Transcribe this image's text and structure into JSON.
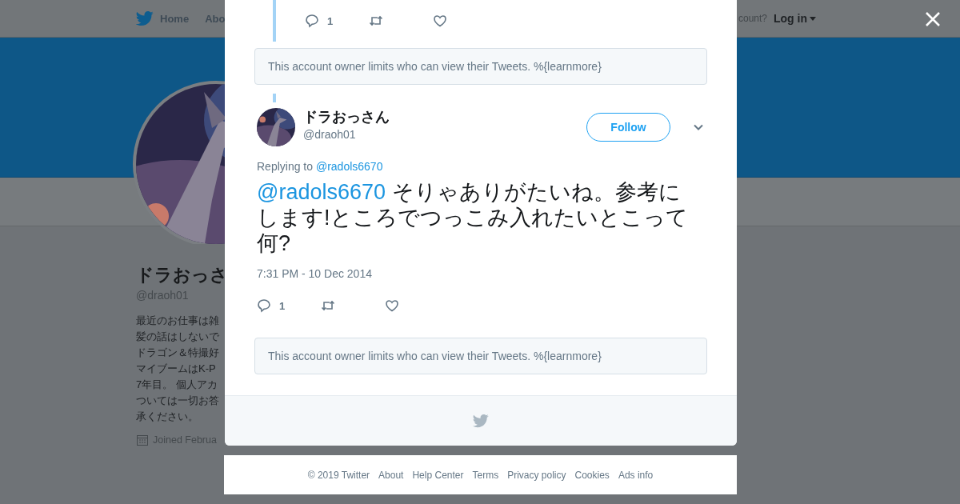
{
  "nav": {
    "items": [
      {
        "label": "Home"
      },
      {
        "label": "Abo"
      }
    ],
    "account_prompt": "count?",
    "login": "Log in"
  },
  "profile": {
    "name": "ドラおっさ",
    "handle": "@draoh01",
    "bio_lines": [
      "最近のお仕事は雑",
      "髪の話はしないで",
      "ドラゴン＆特撮好",
      "マイブームはK-P",
      "7年目。 個人アカ",
      "ついては一切お答",
      "承ください。"
    ],
    "joined": "Joined Februa"
  },
  "modal": {
    "previous_tweet": {
      "reply_count": "1"
    },
    "notices": [
      "This account owner limits who can view their Tweets. %{learnmore}",
      "This account owner limits who can view their Tweets. %{learnmore}"
    ],
    "tweet": {
      "name": "ドラおっさん",
      "handle": "@draoh01",
      "follow_label": "Follow",
      "replying_label": "Replying to",
      "replying_to": "@radols6670",
      "mention": "@radols6670",
      "text": "そりゃありがたいね。参考にします!ところでつっこみ入れたいとこって何?",
      "time": "7:31 PM - 10 Dec 2014",
      "reply_count": "1"
    }
  },
  "footer": [
    "© 2019 Twitter",
    "About",
    "Help Center",
    "Terms",
    "Privacy policy",
    "Cookies",
    "Ads info"
  ]
}
